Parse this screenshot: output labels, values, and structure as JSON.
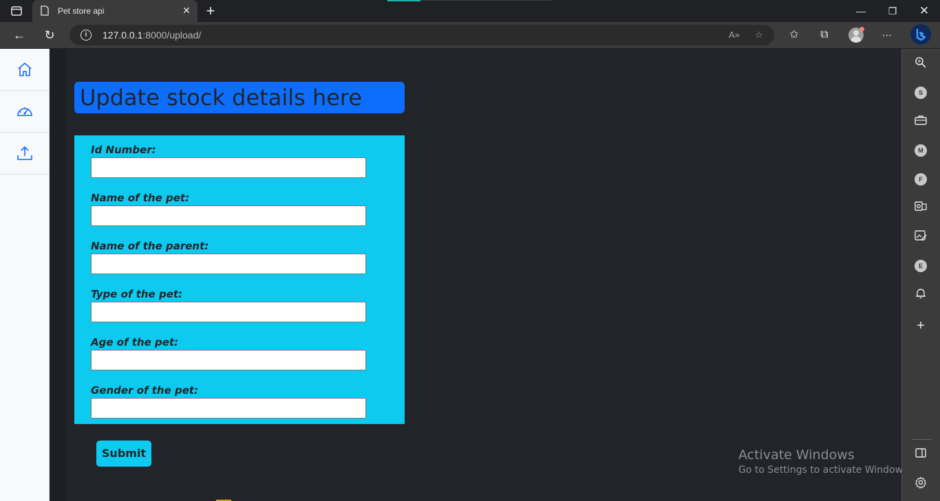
{
  "browser": {
    "tab_title": "Pet store api",
    "url_host": "127.0.0.1",
    "url_path": ":8000/upload/",
    "more_label": "⋯"
  },
  "sidebar": {
    "items": [
      {
        "name": "home"
      },
      {
        "name": "dashboard"
      },
      {
        "name": "upload"
      }
    ]
  },
  "page": {
    "heading": "Update stock details here",
    "fields": [
      {
        "label": "Id Number:",
        "value": ""
      },
      {
        "label": "Name of the pet:",
        "value": ""
      },
      {
        "label": "Name of the parent:",
        "value": ""
      },
      {
        "label": "Type of the pet:",
        "value": ""
      },
      {
        "label": "Age of the pet:",
        "value": ""
      },
      {
        "label": "Gender of the pet:",
        "value": ""
      }
    ],
    "submit_label": "Submit"
  },
  "watermark": {
    "title": "Activate Windows",
    "subtitle": "Go to Settings to activate Windows."
  },
  "edge_sidebar": {
    "letters": [
      "S",
      "M",
      "F",
      "E"
    ]
  },
  "colors": {
    "heading_bg": "#0d6efd",
    "form_bg": "#0dcaf0",
    "page_bg": "#212529"
  }
}
